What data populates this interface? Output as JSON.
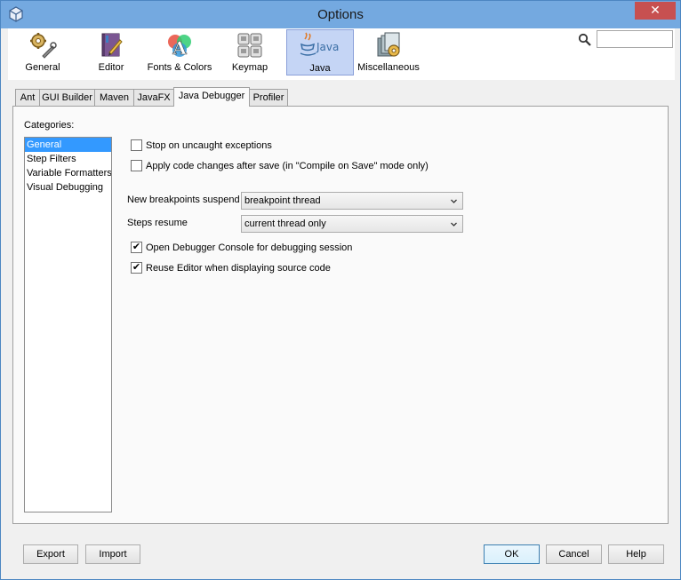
{
  "window": {
    "title": "Options"
  },
  "toolbar": {
    "items": [
      {
        "label": "General",
        "icon": "gears-icon"
      },
      {
        "label": "Editor",
        "icon": "editor-icon"
      },
      {
        "label": "Fonts & Colors",
        "icon": "fonts-colors-icon"
      },
      {
        "label": "Keymap",
        "icon": "keymap-icon"
      },
      {
        "label": "Java",
        "icon": "java-icon",
        "selected": true
      },
      {
        "label": "Miscellaneous",
        "icon": "miscellaneous-icon"
      }
    ],
    "search_value": "",
    "java_logo_text": "Java"
  },
  "tabs": [
    {
      "label": "Ant"
    },
    {
      "label": "GUI Builder"
    },
    {
      "label": "Maven"
    },
    {
      "label": "JavaFX"
    },
    {
      "label": "Java Debugger",
      "active": true
    },
    {
      "label": "Profiler"
    }
  ],
  "categories": {
    "label": "Categories:",
    "items": [
      "General",
      "Step Filters",
      "Variable Formatters",
      "Visual Debugging"
    ],
    "selected": "General"
  },
  "options": {
    "stop_uncaught": {
      "label": "Stop on uncaught exceptions",
      "checked": false
    },
    "apply_code_changes": {
      "label": "Apply code changes after save (in \"Compile on Save\" mode only)",
      "checked": false
    },
    "breakpoints_suspend": {
      "label": "New breakpoints suspend",
      "value": "breakpoint thread"
    },
    "steps_resume": {
      "label": "Steps resume",
      "value": "current thread only"
    },
    "open_console": {
      "label": "Open Debugger Console for debugging session",
      "checked": true
    },
    "reuse_editor": {
      "label": "Reuse Editor when displaying source code",
      "checked": true
    }
  },
  "buttons": {
    "export": "Export",
    "import": "Import",
    "ok": "OK",
    "cancel": "Cancel",
    "help": "Help"
  },
  "colors": {
    "title_bar": "#74a9e0",
    "close_button": "#c75050",
    "selection": "#3399ff",
    "toolbar_selected": "#c5d5f5"
  }
}
